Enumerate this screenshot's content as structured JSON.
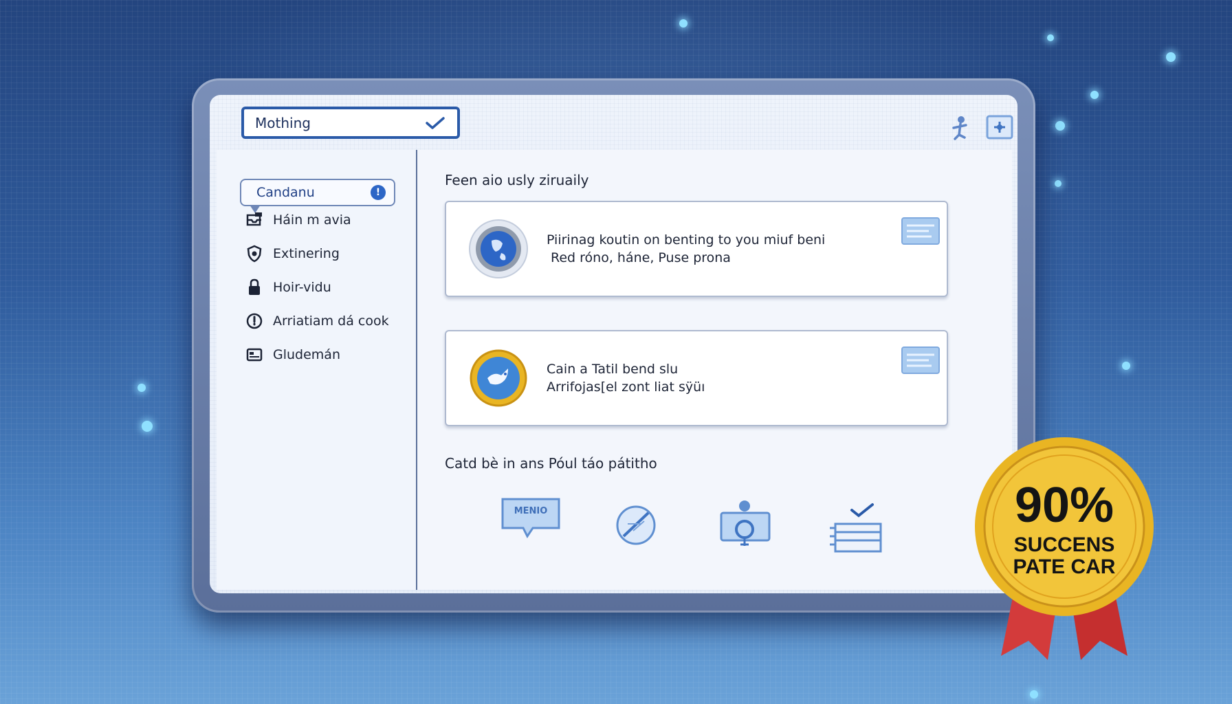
{
  "dropdown": {
    "selected": "Mothing"
  },
  "toolbar_icons": [
    "person-icon",
    "settings-icon"
  ],
  "sidebar": {
    "active_item": {
      "label": "Candanu",
      "badge": "!"
    },
    "items": [
      {
        "label": "Háin m avia",
        "icon": "inbox-icon"
      },
      {
        "label": "Extinering",
        "icon": "shield-icon"
      },
      {
        "label": "Hoir-vidu",
        "icon": "lock-icon"
      },
      {
        "label": "Arriatiam dá cook",
        "icon": "clock-icon"
      },
      {
        "label": "Gludemán",
        "icon": "card-icon"
      }
    ]
  },
  "main": {
    "section1_title": "Feen aio usly ziruaily",
    "cards": [
      {
        "line1": "Piirinag koutin on benting to you miuf beni",
        "line2": "Red róno, háne, Puse prona",
        "icon": "globe-icon"
      },
      {
        "line1": "Cain a Tatil bend slu",
        "line2": "Arrifojas[el zont liat sÿüı",
        "icon": "bird-icon"
      }
    ],
    "section2_title": "Catd bè in ans Póul táo pátitho",
    "bottom_icons": [
      {
        "name": "chat-bubble-icon",
        "text": "MENIO"
      },
      {
        "name": "compass-icon"
      },
      {
        "name": "person-card-icon"
      },
      {
        "name": "checklist-icon"
      }
    ]
  },
  "seal": {
    "percent": "90%",
    "line1": "SUCCENS",
    "line2": "PATE CAR"
  },
  "colors": {
    "accent": "#2a5aa8",
    "gold": "#e9b523",
    "ribbon": "#d33b3b"
  }
}
